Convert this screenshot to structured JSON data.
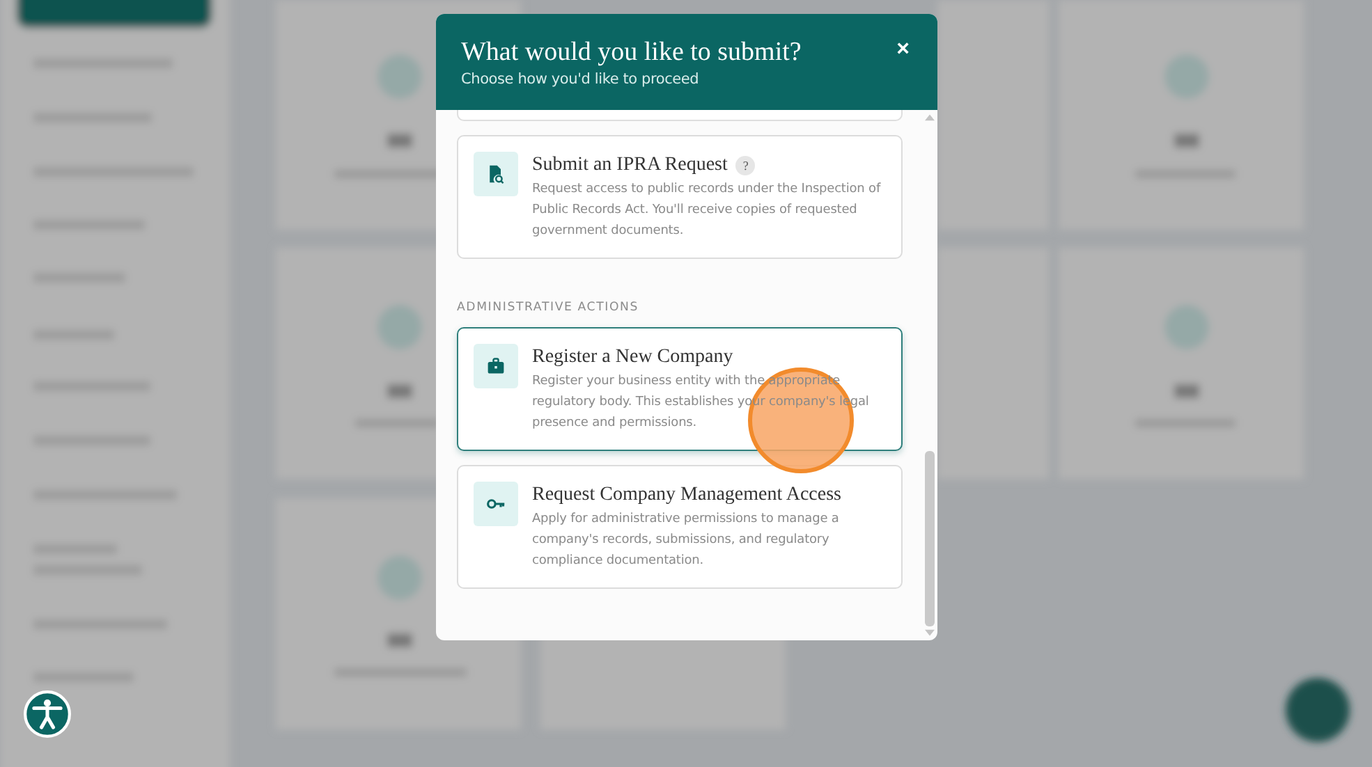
{
  "dialog": {
    "title": "What would you like to submit?",
    "subtitle": "Choose how you'd like to proceed",
    "close": "×",
    "sections": [
      {
        "options": [
          {
            "title": "Submit an IPRA Request",
            "help": "?",
            "description": "Request access to public records under the Inspection of Public Records Act. You'll receive copies of requested government documents.",
            "selected": false
          }
        ]
      },
      {
        "heading": "ADMINISTRATIVE ACTIONS",
        "options": [
          {
            "title": "Register a New Company",
            "description": "Register your business entity with the appropriate regulatory body. This establishes your company's legal presence and permissions.",
            "selected": true
          },
          {
            "title": "Request Company Management Access",
            "description": "Apply for administrative permissions to manage a company's records, submissions, and regulatory compliance documentation.",
            "selected": false
          }
        ]
      }
    ]
  },
  "click_marker": true
}
